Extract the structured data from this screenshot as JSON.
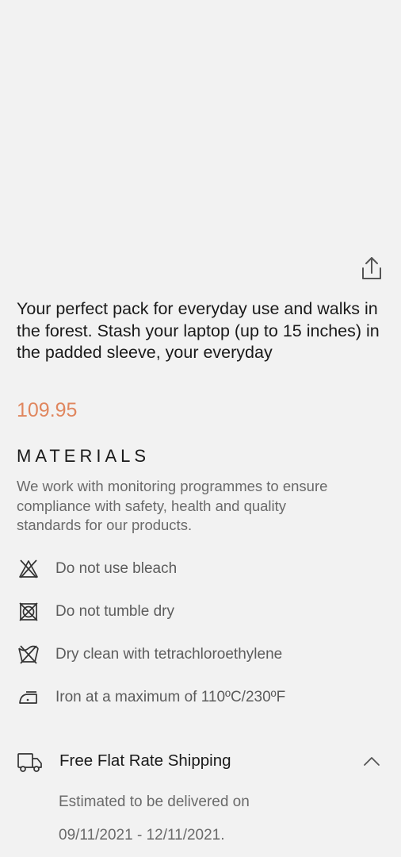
{
  "product": {
    "description": "Your perfect pack for everyday use and walks in the forest. Stash your laptop (up to 15 inches) in the padded sleeve, your everyday",
    "price": "109.95",
    "price_color": "#e0865e"
  },
  "icons": {
    "share": "share-icon",
    "no_bleach": "no-bleach-icon",
    "no_tumble_dry": "no-tumble-dry-icon",
    "dry_clean": "dry-clean-icon",
    "iron": "iron-icon",
    "truck": "truck-icon",
    "chevron": "chevron-up-icon"
  },
  "materials": {
    "title": "MATERIALS",
    "text": "We work with monitoring programmes to ensure compliance with safety, health and quality standards for our products.",
    "care": [
      {
        "label": "Do not use bleach",
        "icon": "no-bleach-icon"
      },
      {
        "label": "Do not tumble dry",
        "icon": "no-tumble-dry-icon"
      },
      {
        "label": "Dry clean with tetrachloroethylene",
        "icon": "dry-clean-icon"
      },
      {
        "label": "Iron at a maximum of 110ºC/230ºF",
        "icon": "iron-icon"
      }
    ]
  },
  "shipping": {
    "title": "Free Flat Rate Shipping",
    "estimate_line1": "Estimated to be delivered on",
    "estimate_line2": "09/11/2021 - 12/11/2021."
  }
}
